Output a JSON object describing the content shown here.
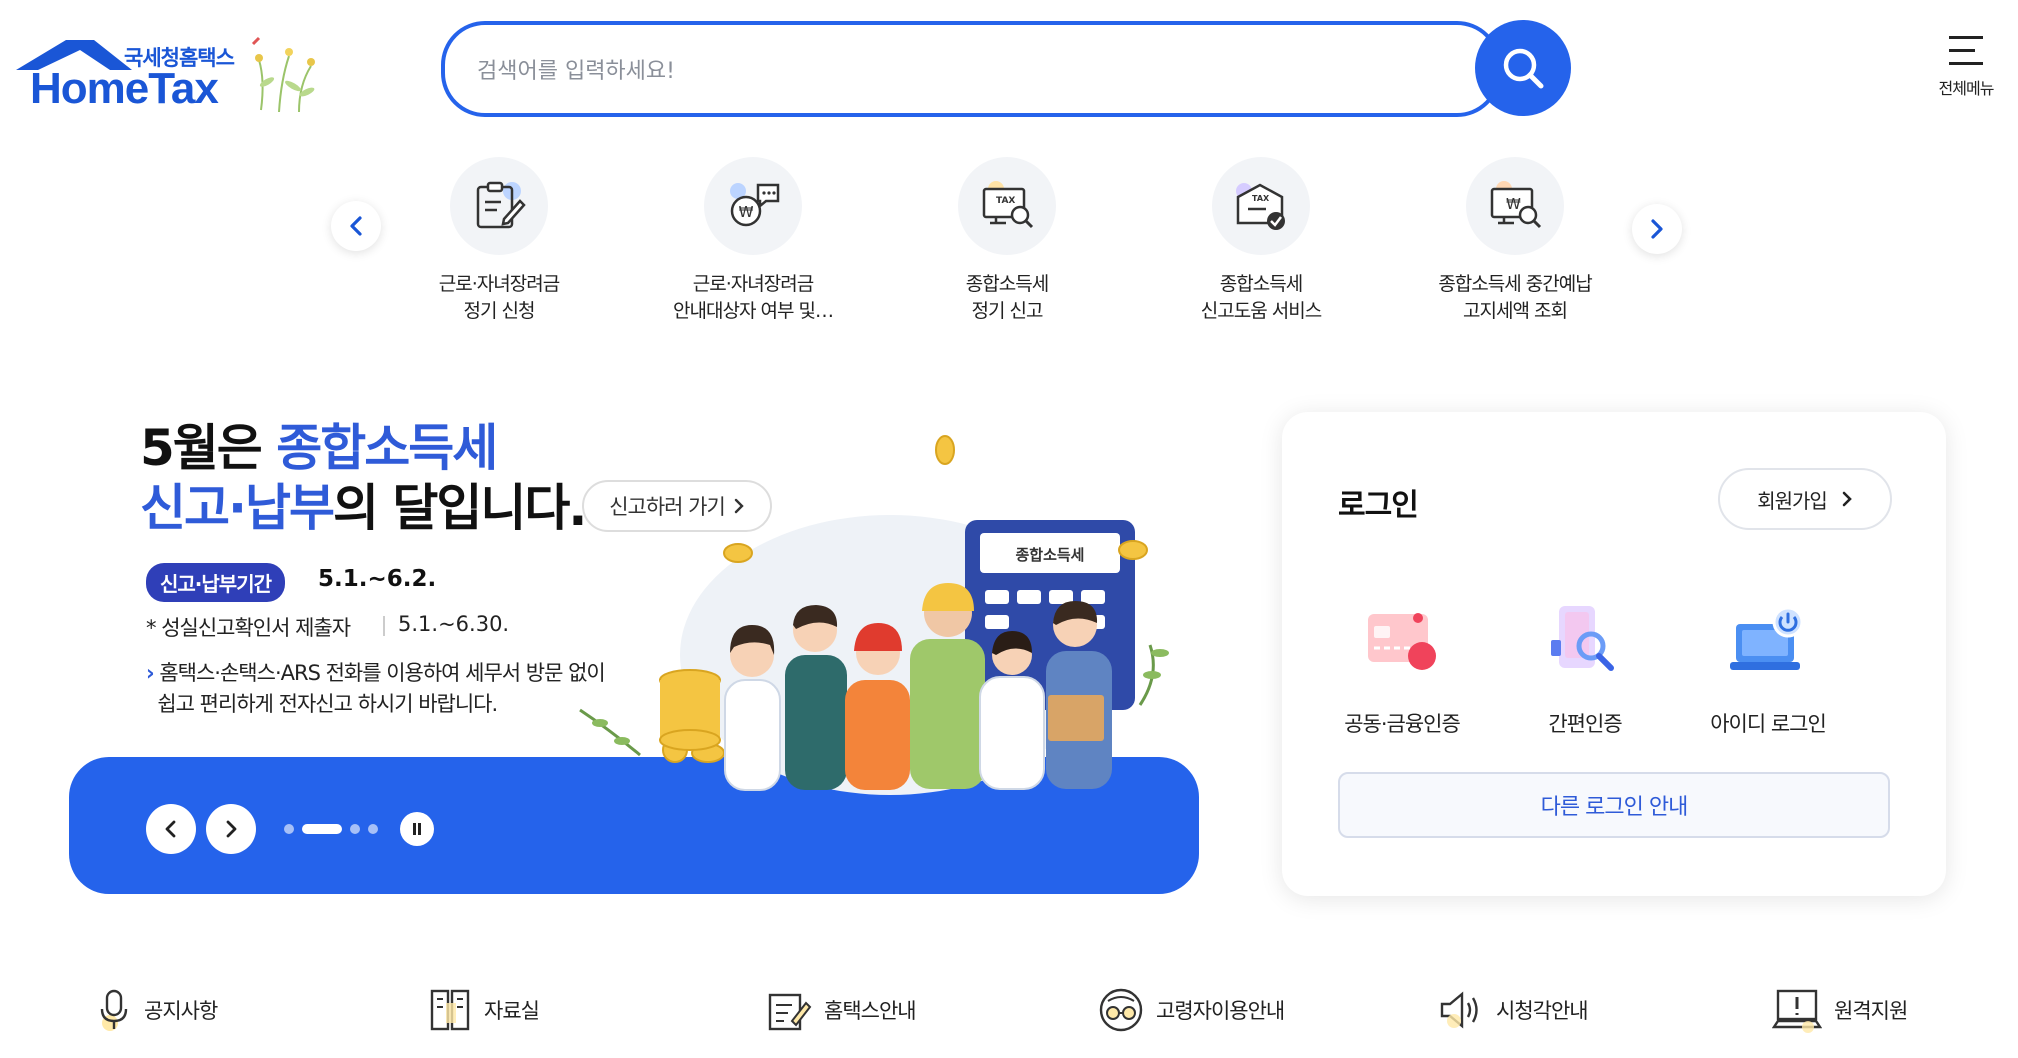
{
  "header": {
    "logo_kr": "국세청홈택스",
    "logo_en": "HomeTax",
    "search_placeholder": "검색어를 입력하세요!",
    "all_menu_label": "전체메뉴"
  },
  "quick_services": [
    {
      "line1": "근로·자녀장려금",
      "line2": "정기 신청",
      "icon": "clipboard-pen-icon"
    },
    {
      "line1": "근로·자녀장려금",
      "line2": "안내대상자 여부 및…",
      "icon": "money-chat-icon"
    },
    {
      "line1": "종합소득세",
      "line2": "정기 신고",
      "icon": "tax-monitor-search-icon"
    },
    {
      "line1": "종합소득세",
      "line2": "신고도움 서비스",
      "icon": "tax-document-check-icon"
    },
    {
      "line1": "종합소득세 중간예납",
      "line2": "고지세액 조회",
      "icon": "won-monitor-search-icon"
    }
  ],
  "banner": {
    "title_part1": "5월은 ",
    "title_highlight1": "종합소득세",
    "title_highlight2": "신고·납부",
    "title_part2": "의 달입니다.",
    "cta_label": "신고하러 가기",
    "period_badge": "신고·납부기간",
    "period": "5.1.~6.2.",
    "sincere_label": "성실신고확인서 제출자",
    "sincere_period": "5.1.~6.30.",
    "desc_line1": "홈택스·손택스·ARS 전화를 이용하여 세무서 방문 없이",
    "desc_line2": "쉽고 편리하게 전자신고 하시기 바랍니다.",
    "calculator_label": "종합소득세",
    "slide_count": 4,
    "active_slide": 2
  },
  "login": {
    "title": "로그인",
    "join_label": "회원가입",
    "options": [
      {
        "label": "공동·금융인증",
        "icon": "certificate-card-icon"
      },
      {
        "label": "간편인증",
        "icon": "phone-search-icon"
      },
      {
        "label": "아이디 로그인",
        "icon": "laptop-power-icon"
      }
    ],
    "other_login_label": "다른 로그인 안내"
  },
  "bottom_links": [
    {
      "label": "공지사항",
      "icon": "microphone-icon"
    },
    {
      "label": "자료실",
      "icon": "archive-cabinet-icon"
    },
    {
      "label": "홈택스안내",
      "icon": "guide-note-icon"
    },
    {
      "label": "고령자이용안내",
      "icon": "senior-glasses-icon"
    },
    {
      "label": "시청각안내",
      "icon": "speaker-icon"
    },
    {
      "label": "원격지원",
      "icon": "remote-support-icon"
    }
  ],
  "colors": {
    "primary": "#2563eb",
    "highlight": "#2f5bd8",
    "badge": "#2f3fb8"
  }
}
